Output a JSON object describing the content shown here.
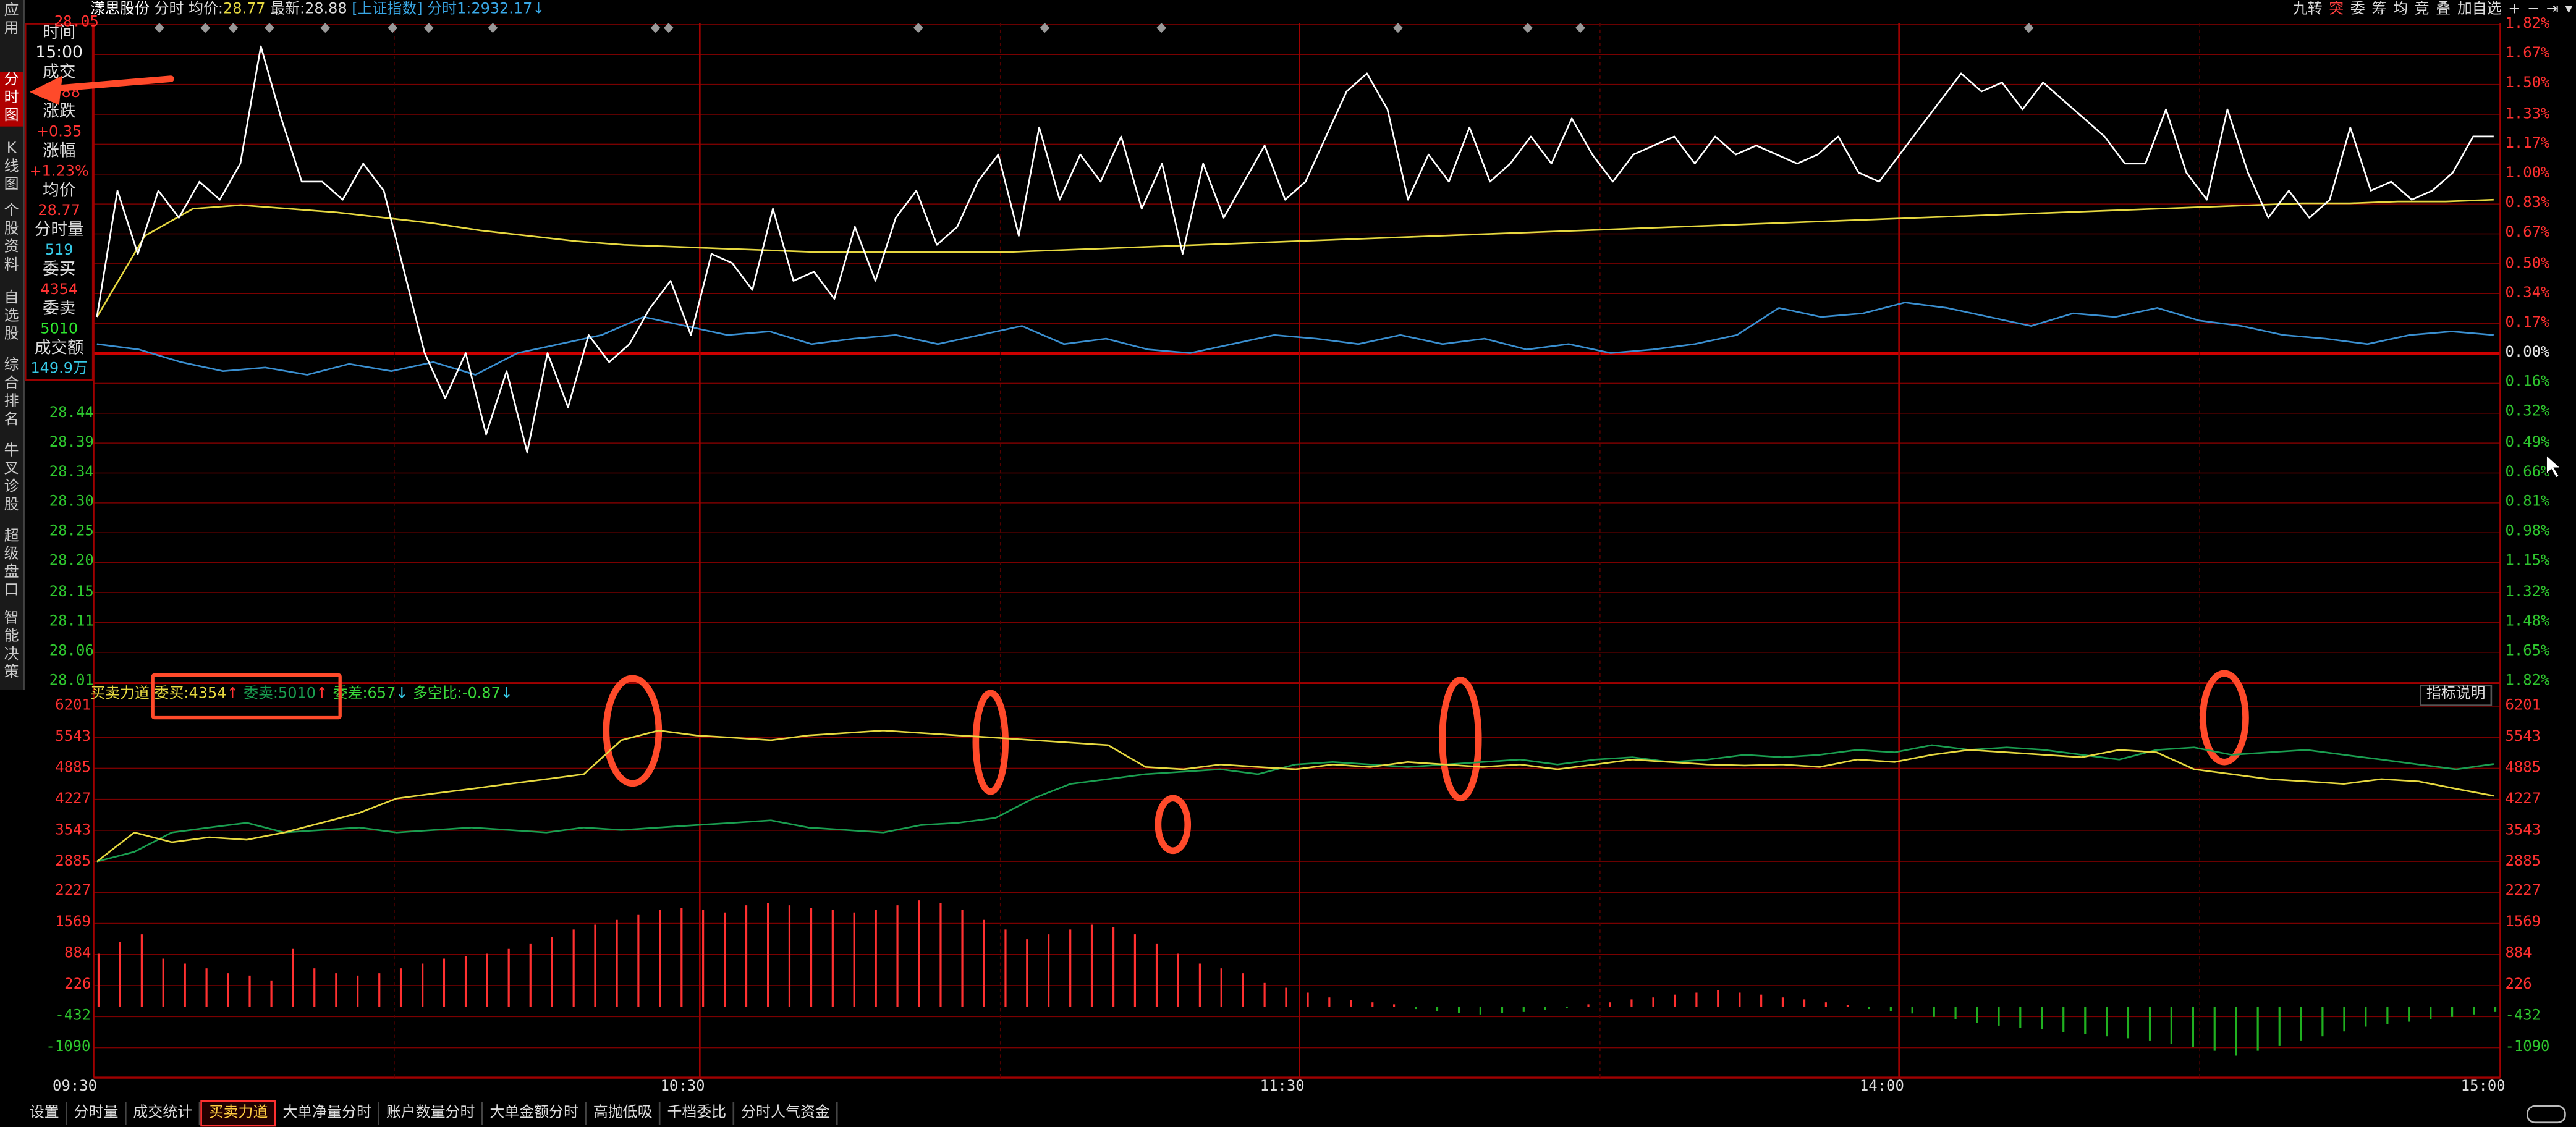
{
  "title_bar": {
    "stock_name": "漾思股份",
    "mode": "分时",
    "avg_label": "均价:",
    "avg_value": "28.77",
    "last_label": "最新:",
    "last_value": "28.88",
    "index_label": "[上证指数]",
    "index_time_label": "分时1:",
    "index_value": "2932.17",
    "index_arrow": "↓"
  },
  "tools": [
    "九转",
    "突",
    "委",
    "筹",
    "均",
    "竞",
    "叠",
    "加自选",
    "+",
    "−",
    "⇥",
    "▾"
  ],
  "side_tabs": [
    {
      "label": "应用",
      "active": false
    },
    {
      "label": "分时图",
      "active": true
    },
    {
      "label": "K线图",
      "active": false
    },
    {
      "label": "个股资料",
      "active": false
    },
    {
      "label": "自选股",
      "active": false
    },
    {
      "label": "综合排名",
      "active": false
    },
    {
      "label": "牛叉诊股",
      "active": false
    },
    {
      "label": "超级盘口",
      "active": false
    },
    {
      "label": "智能决策",
      "active": false
    }
  ],
  "info_panel": {
    "time_label": "时间",
    "time_value": "15:00",
    "price_label": "成交",
    "price_value": "28.88",
    "change_label": "涨跌",
    "change_value": "+0.35",
    "pct_label": "涨幅",
    "pct_value": "+1.23%",
    "avg_label": "均价",
    "avg_value": "28.77",
    "vol_label": "分时量",
    "vol_value": "519",
    "bid_label": "委买",
    "bid_value": "4354",
    "ask_label": "委卖",
    "ask_value": "5010",
    "amt_label": "成交额",
    "amt_value": "149.9万"
  },
  "price_axis_left": [
    "28.05",
    "28.44",
    "28.39",
    "28.34",
    "28.30",
    "28.25",
    "28.20",
    "28.15",
    "28.11",
    "28.06",
    "28.01"
  ],
  "price_axis_right_up": [
    "1.82%",
    "1.67%",
    "1.50%",
    "1.33%",
    "1.17%",
    "1.00%",
    "0.83%",
    "0.67%",
    "0.50%",
    "0.34%",
    "0.17%",
    "0.00%"
  ],
  "price_axis_right_down": [
    "0.16%",
    "0.32%",
    "0.49%",
    "0.66%",
    "0.81%",
    "0.98%",
    "1.15%",
    "1.32%",
    "1.48%",
    "1.65%",
    "1.82%"
  ],
  "indicator_bar": {
    "title": "买卖力道",
    "buy_label": "委买:",
    "buy_value": "4354",
    "buy_arrow": "↑",
    "sell_label": "委卖:",
    "sell_value": "5010",
    "sell_arrow": "↑",
    "diff_label": "委差:",
    "diff_value": "657",
    "diff_arrow": "↓",
    "ratio_label": "多空比:",
    "ratio_value": "-0.87",
    "ratio_arrow": "↓",
    "help_label": "指标说明"
  },
  "indicator_axis": [
    "6201",
    "5543",
    "4885",
    "4227",
    "3543",
    "2885",
    "2227",
    "1569",
    "884",
    "226",
    "-432",
    "-1090"
  ],
  "time_axis": [
    "09:30",
    "10:30",
    "11:30",
    "14:00",
    "15:00"
  ],
  "bottom_tabs": [
    {
      "label": "设置",
      "active": false
    },
    {
      "label": "分时量",
      "active": false
    },
    {
      "label": "成交统计",
      "active": false
    },
    {
      "label": "买卖力道",
      "active": true
    },
    {
      "label": "大单净量分时",
      "active": false
    },
    {
      "label": "账户数量分时",
      "active": false
    },
    {
      "label": "大单金额分时",
      "active": false
    },
    {
      "label": "高抛低吸",
      "active": false
    },
    {
      "label": "千档委比",
      "active": false
    },
    {
      "label": "分时人气资金",
      "active": false
    }
  ],
  "colors": {
    "grid": "#7a0000",
    "price_line": "#ffffff",
    "avg_line": "#e6d840",
    "index_line": "#3a8fd0",
    "buy_line": "#e6d840",
    "sell_line": "#1a9e50",
    "bar_up": "#ff3030",
    "bar_down": "#20b020",
    "annotation": "#ff4a2a"
  },
  "chart_data": [
    {
      "type": "line",
      "x_range": [
        "09:30",
        "15:00"
      ],
      "yaxis_left": [
        28.01,
        28.05
      ],
      "yaxis_right_pct_range": [
        -1.82,
        1.82
      ],
      "series": [
        {
          "values": [
            0.2,
            0.9,
            0.55,
            0.9,
            0.75,
            0.95,
            0.85,
            1.05,
            1.7,
            1.3,
            0.95,
            0.95,
            0.85,
            1.05,
            0.9,
            0.45,
            0.0,
            -0.25,
            0.0,
            -0.45,
            -0.1,
            -0.55,
            0.0,
            -0.3,
            0.1,
            -0.05,
            0.05,
            0.25,
            0.4,
            0.1,
            0.55,
            0.5,
            0.35,
            0.8,
            0.4,
            0.45,
            0.3,
            0.7,
            0.4,
            0.75,
            0.9,
            0.6,
            0.7,
            0.95,
            1.1,
            0.65,
            1.25,
            0.85,
            1.1,
            0.95,
            1.2,
            0.8,
            1.05,
            0.55,
            1.05,
            0.75,
            0.95,
            1.15,
            0.85,
            0.95,
            1.2,
            1.45,
            1.55,
            1.35,
            0.85,
            1.1,
            0.95,
            1.25,
            0.95,
            1.05,
            1.2,
            1.05,
            1.3,
            1.1,
            0.95,
            1.1,
            1.15,
            1.2,
            1.05,
            1.2,
            1.1,
            1.15,
            1.1,
            1.05,
            1.1,
            1.2,
            1.0,
            0.95,
            1.1,
            1.25,
            1.4,
            1.55,
            1.45,
            1.5,
            1.35,
            1.5,
            1.4,
            1.3,
            1.2,
            1.05,
            1.05,
            1.35,
            1.0,
            0.85,
            1.35,
            1.0,
            0.75,
            0.9,
            0.75,
            0.85,
            1.25,
            0.9,
            0.95,
            0.85,
            0.9,
            1.0,
            1.2,
            1.2
          ]
        },
        {
          "values": [
            0.2,
            0.65,
            0.8,
            0.82,
            0.8,
            0.78,
            0.75,
            0.72,
            0.68,
            0.65,
            0.62,
            0.6,
            0.59,
            0.58,
            0.57,
            0.56,
            0.56,
            0.56,
            0.56,
            0.56,
            0.57,
            0.58,
            0.59,
            0.6,
            0.61,
            0.62,
            0.63,
            0.64,
            0.65,
            0.66,
            0.67,
            0.68,
            0.69,
            0.7,
            0.71,
            0.72,
            0.73,
            0.74,
            0.75,
            0.76,
            0.77,
            0.78,
            0.79,
            0.8,
            0.81,
            0.82,
            0.83,
            0.83,
            0.84,
            0.84,
            0.85
          ]
        },
        {
          "values": [
            0.05,
            0.02,
            -0.05,
            -0.1,
            -0.08,
            -0.12,
            -0.06,
            -0.1,
            -0.05,
            -0.12,
            0.0,
            0.05,
            0.1,
            0.2,
            0.15,
            0.1,
            0.12,
            0.05,
            0.08,
            0.1,
            0.05,
            0.1,
            0.15,
            0.05,
            0.08,
            0.02,
            0.0,
            0.05,
            0.1,
            0.08,
            0.05,
            0.1,
            0.05,
            0.08,
            0.02,
            0.05,
            0.0,
            0.02,
            0.05,
            0.1,
            0.25,
            0.2,
            0.22,
            0.28,
            0.25,
            0.2,
            0.15,
            0.22,
            0.2,
            0.25,
            0.18,
            0.15,
            0.1,
            0.08,
            0.05,
            0.1,
            0.12,
            0.1
          ]
        }
      ]
    },
    {
      "type": "line",
      "x_range": [
        "09:30",
        "15:00"
      ],
      "ylim": [
        -1090,
        6201
      ],
      "series": [
        {
          "name": "委买",
          "values": [
            3000,
            3600,
            3400,
            3500,
            3450,
            3600,
            3800,
            4000,
            4300,
            4400,
            4500,
            4600,
            4700,
            4800,
            5500,
            5700,
            5600,
            5550,
            5500,
            5600,
            5650,
            5700,
            5650,
            5600,
            5550,
            5500,
            5450,
            5400,
            4950,
            4900,
            5000,
            4950,
            4900,
            5000,
            4950,
            5050,
            5000,
            4950,
            5000,
            4900,
            5000,
            5100,
            5050,
            5000,
            4980,
            5000,
            4950,
            5100,
            5050,
            5200,
            5300,
            5250,
            5200,
            5150,
            5300,
            5250,
            4900,
            4800,
            4700,
            4650,
            4600,
            4700,
            4650,
            4500,
            4354
          ]
        },
        {
          "name": "委卖",
          "values": [
            3000,
            3200,
            3600,
            3700,
            3800,
            3600,
            3650,
            3700,
            3600,
            3650,
            3700,
            3650,
            3600,
            3700,
            3650,
            3700,
            3750,
            3800,
            3850,
            3700,
            3650,
            3600,
            3750,
            3800,
            3900,
            4300,
            4600,
            4700,
            4800,
            4850,
            4900,
            4800,
            5000,
            5050,
            5000,
            4950,
            5000,
            5050,
            5100,
            5000,
            5100,
            5150,
            5050,
            5100,
            5200,
            5150,
            5200,
            5300,
            5250,
            5400,
            5300,
            5350,
            5300,
            5200,
            5100,
            5300,
            5350,
            5200,
            5250,
            5300,
            5200,
            5100,
            5000,
            4900,
            5010
          ]
        }
      ]
    },
    {
      "type": "bar",
      "x_range": [
        "09:30",
        "15:00"
      ],
      "ylim": [
        -1090,
        6201
      ],
      "values": [
        1100,
        1350,
        1500,
        1000,
        900,
        800,
        700,
        650,
        550,
        1200,
        800,
        700,
        650,
        700,
        800,
        900,
        1000,
        1050,
        1100,
        1200,
        1300,
        1450,
        1600,
        1700,
        1800,
        1900,
        2000,
        2050,
        2000,
        1950,
        2100,
        2150,
        2100,
        2050,
        2000,
        1950,
        2000,
        2100,
        2200,
        2150,
        2000,
        1800,
        1600,
        1400,
        1500,
        1600,
        1700,
        1650,
        1500,
        1300,
        1100,
        900,
        800,
        700,
        500,
        400,
        300,
        200,
        150,
        100,
        60,
        -40,
        -80,
        -120,
        -150,
        -120,
        -100,
        -60,
        -20,
        60,
        100,
        160,
        200,
        260,
        300,
        350,
        300,
        260,
        200,
        160,
        100,
        50,
        -40,
        -80,
        -130,
        -200,
        -250,
        -320,
        -380,
        -430,
        -460,
        -520,
        -560,
        -600,
        -640,
        -700,
        -760,
        -820,
        -900,
        -1000,
        -900,
        -800,
        -700,
        -600,
        -500,
        -400,
        -350,
        -300,
        -250,
        -200,
        -150,
        -100
      ]
    }
  ]
}
